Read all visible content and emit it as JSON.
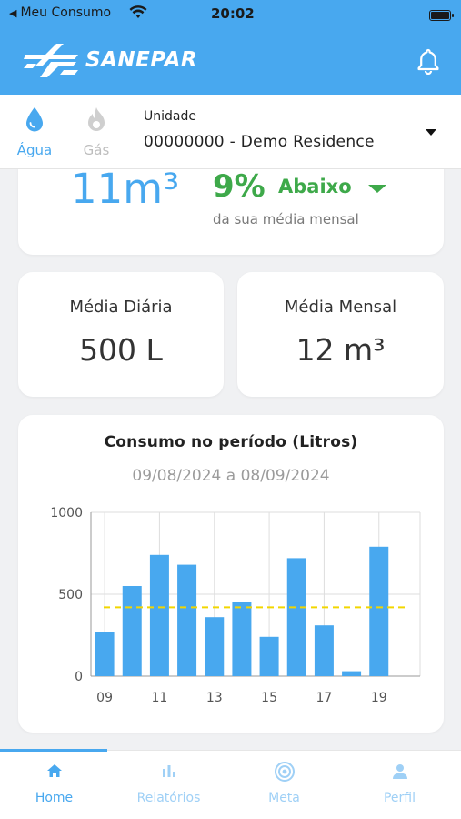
{
  "status_bar": {
    "carrier": "Meu Consumo",
    "time": "20:02"
  },
  "header": {
    "brand": "SANEPAR"
  },
  "utilities": {
    "agua_label": "Água",
    "gas_label": "Gás"
  },
  "unit": {
    "caption": "Unidade",
    "value": "00000000 - Demo Residence"
  },
  "summary": {
    "consumption": "11m³",
    "percent": "9%",
    "direction": "Abaixo",
    "subtitle": "da sua média mensal"
  },
  "averages": {
    "daily_title": "Média Diária",
    "daily_value": "500 L",
    "monthly_title": "Média Mensal",
    "monthly_value": "12 m³"
  },
  "chart": {
    "title": "Consumo no período (Litros)",
    "period": "09/08/2024 a 08/09/2024"
  },
  "chart_data": {
    "type": "bar",
    "x": [
      9,
      10,
      11,
      12,
      13,
      14,
      15,
      16,
      17,
      18,
      19
    ],
    "values": [
      270,
      550,
      740,
      680,
      360,
      450,
      240,
      720,
      310,
      30,
      790
    ],
    "x_tick_labels": [
      "09",
      "11",
      "13",
      "15",
      "17",
      "19"
    ],
    "y_tick_labels": [
      "0",
      "500",
      "1000"
    ],
    "ylim": [
      0,
      1000
    ],
    "average_line": 420,
    "grid": true,
    "bar_color": "#48a8ef",
    "average_color": "#f2d600"
  },
  "nav": {
    "home": "Home",
    "reports": "Relatórios",
    "goal": "Meta",
    "profile": "Perfil"
  },
  "colors": {
    "primary": "#48a8ef",
    "positive": "#3ea94a"
  }
}
